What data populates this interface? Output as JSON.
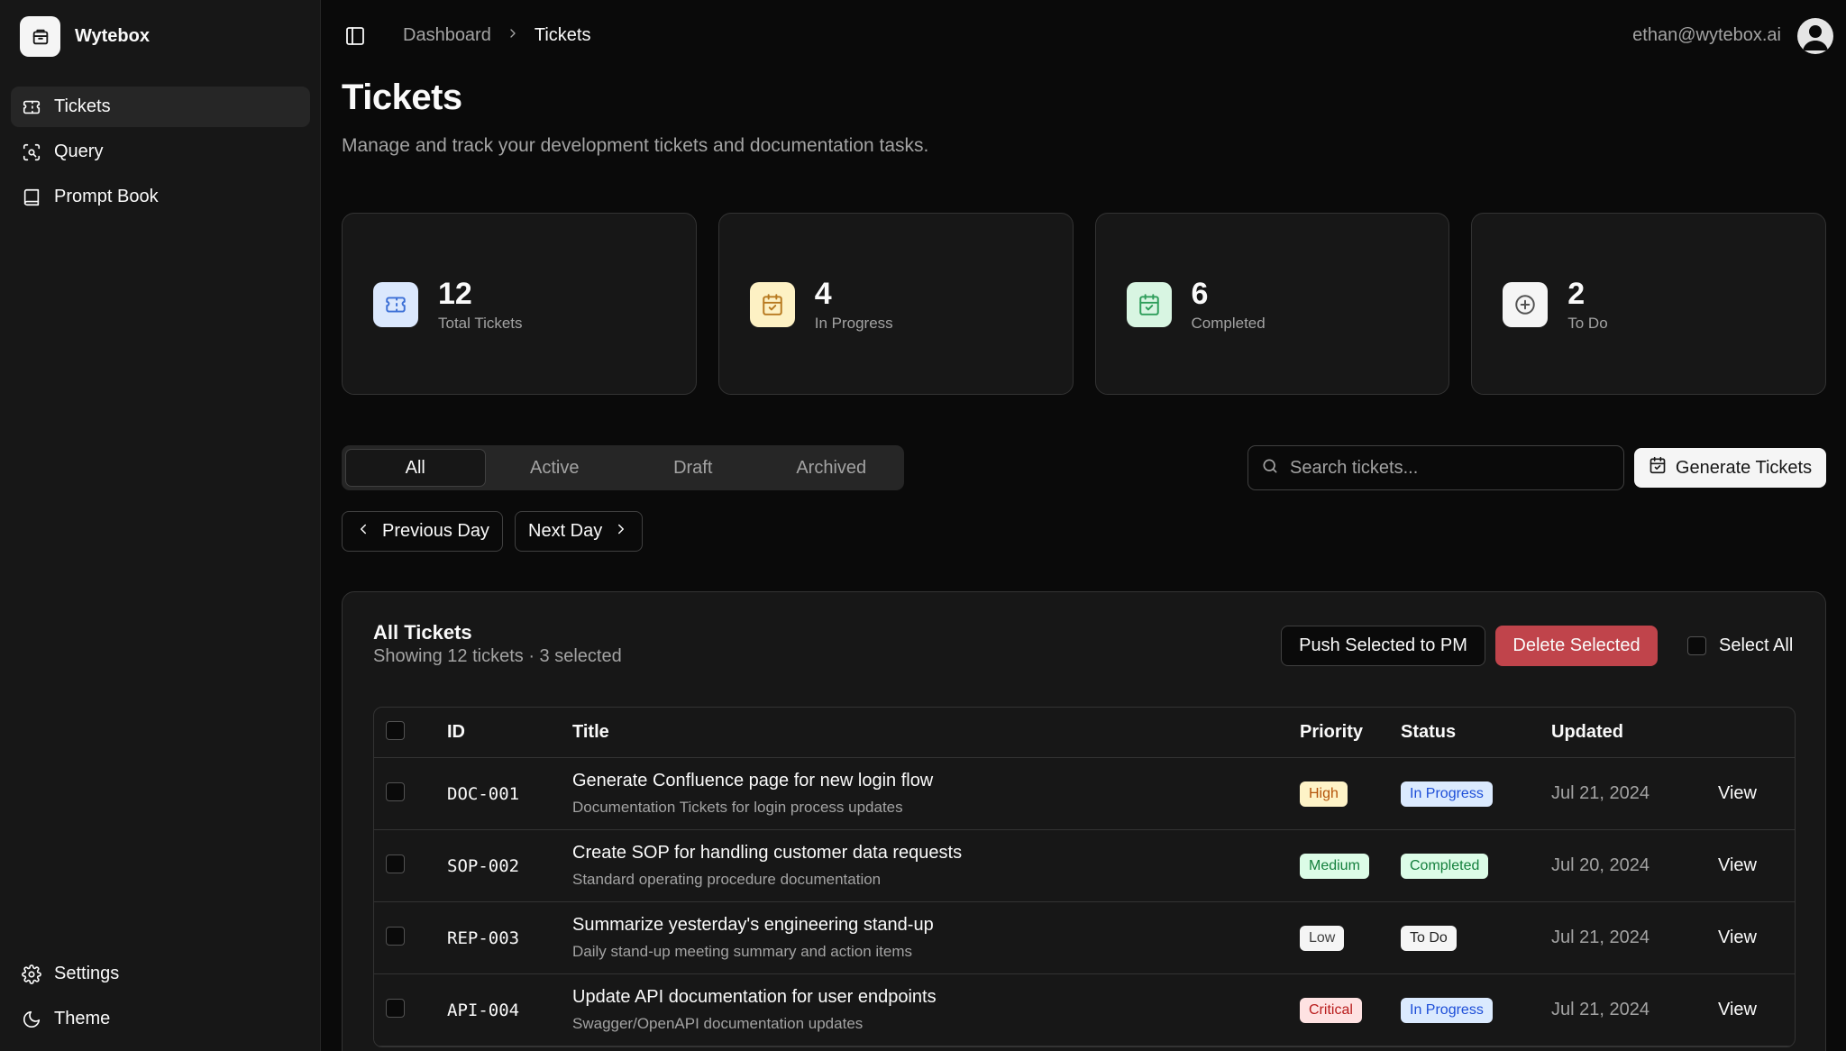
{
  "brand": {
    "name": "Wytebox"
  },
  "sidebar": {
    "items": [
      {
        "label": "Tickets",
        "icon": "ticket-icon",
        "active": true
      },
      {
        "label": "Query",
        "icon": "scan-search-icon",
        "active": false
      },
      {
        "label": "Prompt Book",
        "icon": "book-icon",
        "active": false
      }
    ],
    "bottom": [
      {
        "label": "Settings",
        "icon": "gear-icon"
      },
      {
        "label": "Theme",
        "icon": "moon-icon"
      }
    ]
  },
  "header": {
    "breadcrumb": [
      "Dashboard",
      "Tickets"
    ],
    "user_email": "ethan@wytebox.ai"
  },
  "page": {
    "title": "Tickets",
    "description": "Manage and track your development tickets and documentation tasks."
  },
  "stats": [
    {
      "value": "12",
      "label": "Total Tickets",
      "icon": "ticket-icon",
      "color": "#3b6fd6",
      "bg": "#dbe8fd"
    },
    {
      "value": "4",
      "label": "In Progress",
      "icon": "calendar-clock-icon",
      "color": "#b7791f",
      "bg": "#fdf1c4"
    },
    {
      "value": "6",
      "label": "Completed",
      "icon": "calendar-check-icon",
      "color": "#2f9e5b",
      "bg": "#d8f5e2"
    },
    {
      "value": "2",
      "label": "To Do",
      "icon": "plus-circle-icon",
      "color": "#525252",
      "bg": "#f5f5f5"
    }
  ],
  "tabs": [
    "All",
    "Active",
    "Draft",
    "Archived"
  ],
  "active_tab": "All",
  "search": {
    "placeholder": "Search tickets..."
  },
  "buttons": {
    "generate": "Generate Tickets",
    "previous_day": "Previous Day",
    "next_day": "Next Day",
    "push_selected": "Push Selected to PM",
    "delete_selected": "Delete Selected",
    "select_all": "Select All"
  },
  "table_card": {
    "title": "All Tickets",
    "subtitle": "Showing 12 tickets · 3 selected",
    "columns": [
      "ID",
      "Title",
      "Priority",
      "Status",
      "Updated"
    ],
    "rows": [
      {
        "id": "DOC-001",
        "title": "Generate Confluence page for new login flow",
        "subtitle": "Documentation Tickets for login process updates",
        "priority": "High",
        "status": "In Progress",
        "updated": "Jul 21, 2024",
        "action": "View"
      },
      {
        "id": "SOP-002",
        "title": "Create SOP for handling customer data requests",
        "subtitle": "Standard operating procedure documentation",
        "priority": "Medium",
        "status": "Completed",
        "updated": "Jul 20, 2024",
        "action": "View"
      },
      {
        "id": "REP-003",
        "title": "Summarize yesterday's engineering stand-up",
        "subtitle": "Daily stand-up meeting summary and action items",
        "priority": "Low",
        "status": "To Do",
        "updated": "Jul 21, 2024",
        "action": "View"
      },
      {
        "id": "API-004",
        "title": "Update API documentation for user endpoints",
        "subtitle": "Swagger/OpenAPI documentation updates",
        "priority": "Critical",
        "status": "In Progress",
        "updated": "Jul 21, 2024",
        "action": "View"
      }
    ]
  },
  "badge_colors": {
    "High": {
      "bg": "#fef3c7",
      "fg": "#b45309"
    },
    "Medium": {
      "bg": "#dcfce7",
      "fg": "#15803d"
    },
    "Low": {
      "bg": "#f5f5f5",
      "fg": "#404040"
    },
    "Critical": {
      "bg": "#fee2e2",
      "fg": "#b91c1c"
    },
    "In Progress": {
      "bg": "#dbeafe",
      "fg": "#1d4ed8"
    },
    "Completed": {
      "bg": "#dcfce7",
      "fg": "#15803d"
    },
    "To Do": {
      "bg": "#f5f5f5",
      "fg": "#262626"
    }
  }
}
